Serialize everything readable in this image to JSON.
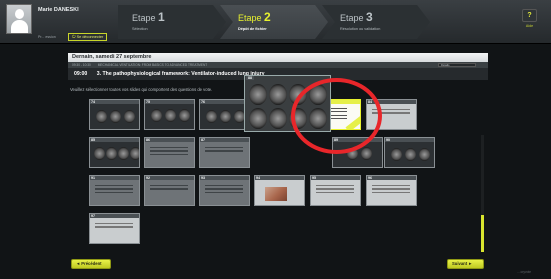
{
  "user": {
    "name": "Marie DANESKI",
    "profile_link": "Pr... ession",
    "logout_label": "Se déconnecter"
  },
  "steps": [
    {
      "label": "Etape",
      "number": "1",
      "subtitle": "Sélection"
    },
    {
      "label": "Etape",
      "number": "2",
      "subtitle": "Dépôt de fichier"
    },
    {
      "label": "Etape",
      "number": "3",
      "subtitle": "Résolution ou validation"
    }
  ],
  "help": {
    "icon": "?",
    "label": "Aide"
  },
  "schedule": {
    "day": "Dernain, samedi 27 septembre",
    "session_time": "09:30 - 10:30",
    "session_name": "MECHANICAL VENTILATION: FROM BASICS TO ADVANCED TREATMENT",
    "session_action": "Détails",
    "talk_time": "09:00",
    "talk_title": "3. The pathophysiological framework: Ventilator-induced lung injury"
  },
  "instruction": "Veuillez sélectionner toutes vos slides qui comportent des questions de vote.",
  "slides": [
    "74",
    "75",
    "76",
    "82",
    "83",
    "84",
    "85",
    "86",
    "87",
    "88",
    "89",
    "90",
    "91",
    "92",
    "93",
    "94",
    "95",
    "96",
    "97"
  ],
  "navigation": {
    "prev_label": "◄ Précédent",
    "next_label": "Suivant ►"
  },
  "brand": "... oryvote"
}
